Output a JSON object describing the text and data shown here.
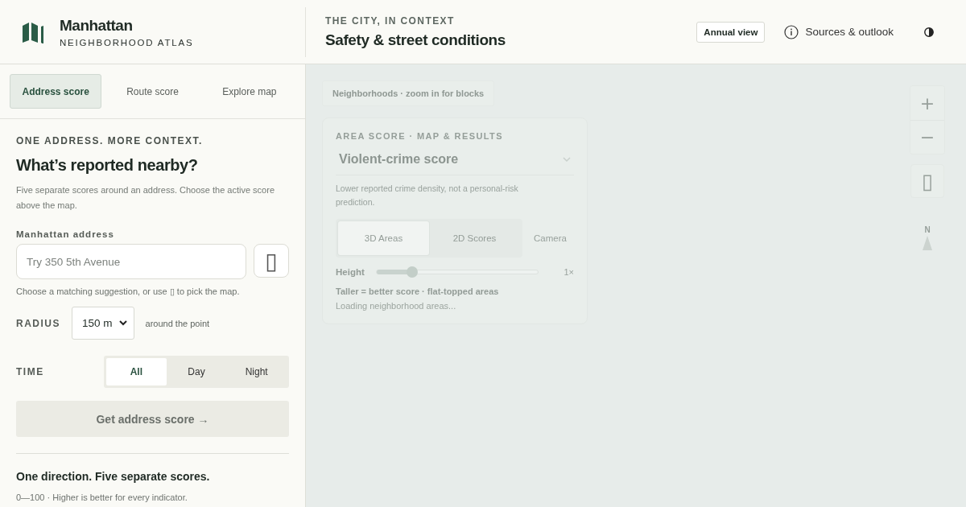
{
  "brand": {
    "title": "Manhattan",
    "subtitle": "NEIGHBORHOOD ATLAS"
  },
  "header": {
    "eyebrow": "THE CITY, IN CONTEXT",
    "title": "Safety & street conditions",
    "actions": [
      {
        "kind": "button",
        "label": "Annual view"
      },
      {
        "kind": "info",
        "label": "Sources & outlook"
      },
      {
        "kind": "theme"
      }
    ]
  },
  "tabs": [
    {
      "label": "Address score",
      "selected": true
    },
    {
      "label": "Route score",
      "selected": false
    },
    {
      "label": "Explore map",
      "selected": false
    }
  ],
  "panel": {
    "eyebrow": "ONE ADDRESS. MORE CONTEXT.",
    "title": "What’s reported nearby?",
    "intro": "Five separate scores around an address. Choose the active score above the map.",
    "address": {
      "label": "Manhattan address",
      "placeholder": "Try 350 5th Avenue",
      "locate": "▯",
      "hint": "Choose a matching suggestion, or use ▯ to pick the map."
    },
    "radius": {
      "label": "RADIUS",
      "value": "150 m",
      "suffix": "around the point"
    },
    "time": {
      "label": "TIME",
      "options": [
        {
          "label": "All",
          "selected": true
        },
        {
          "label": "Day",
          "selected": false
        },
        {
          "label": "Night",
          "selected": false
        }
      ]
    },
    "submit": "Get address score →",
    "legend_title": "One direction. Five separate scores.",
    "legend_note": "0—100 · Higher is better for every indicator."
  },
  "map": {
    "zoom_hint": "Neighborhoods · zoom in for blocks",
    "controls": [
      "+",
      "−",
      "▯"
    ],
    "north": "N",
    "card": {
      "eyebrow": "AREA SCORE · MAP & RESULTS",
      "metric": "Violent-crime score",
      "note": "Lower reported crime density, not a personal-risk prediction.",
      "modes": [
        {
          "label": "3D Areas",
          "selected": true
        },
        {
          "label": "2D Scores",
          "selected": false
        }
      ],
      "camera": "Camera",
      "height": {
        "label": "Height",
        "level": 0.22,
        "reading": "1×"
      },
      "caption": "Taller = better score · flat-topped areas",
      "status": "Loading neighborhood areas..."
    }
  }
}
